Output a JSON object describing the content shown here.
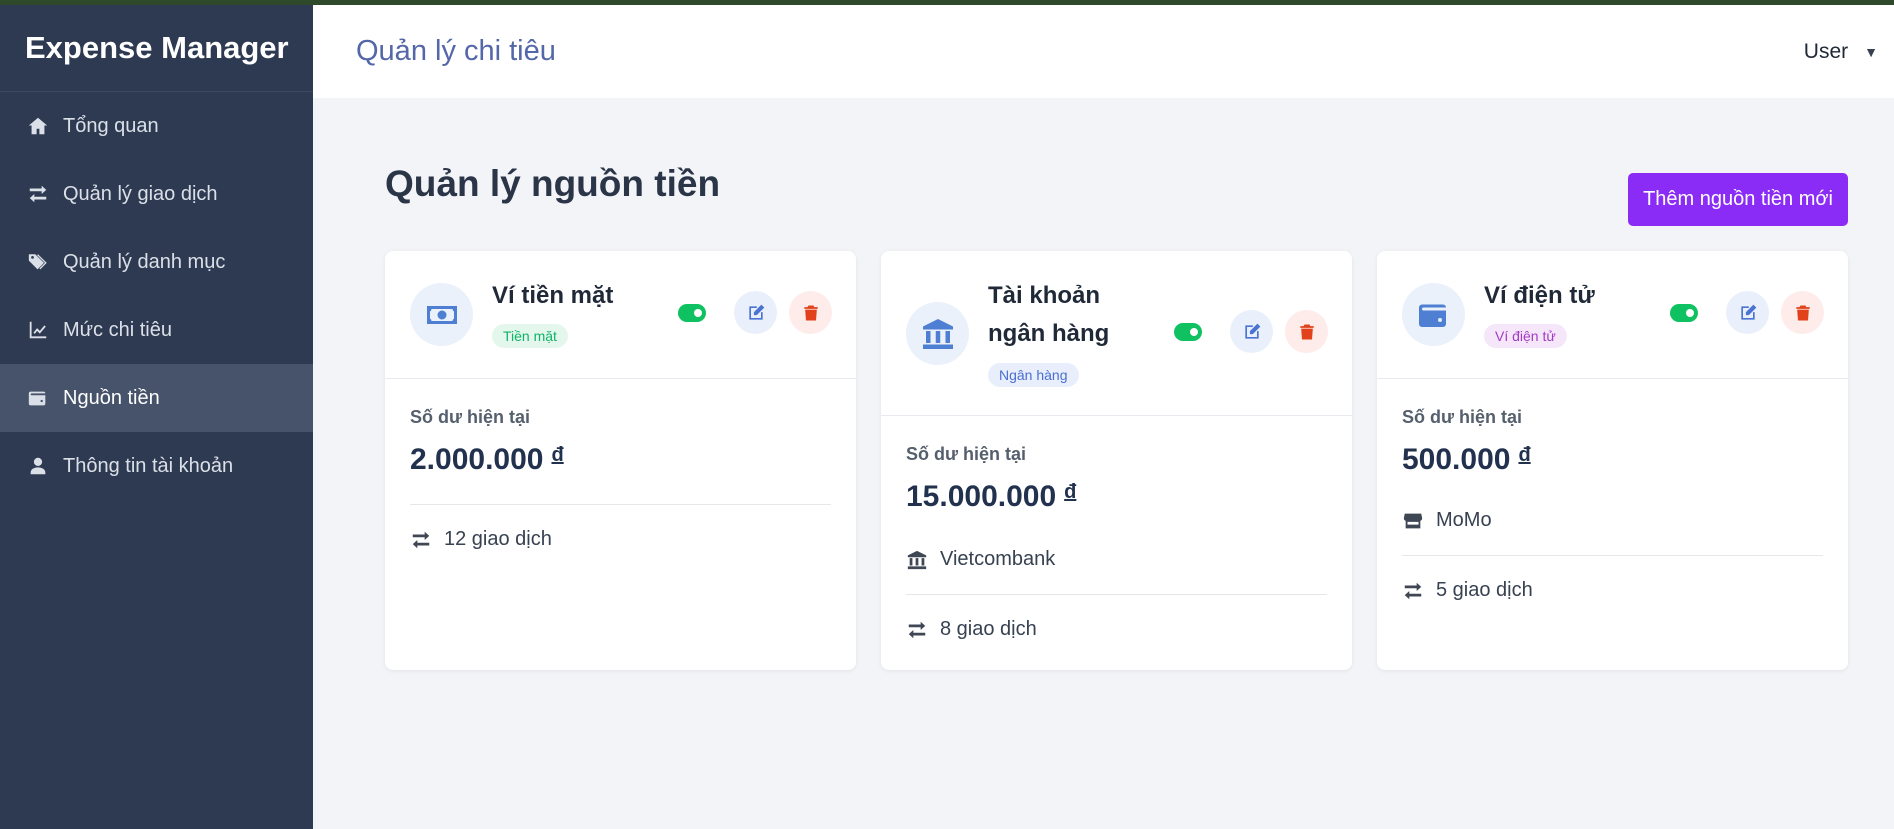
{
  "app": {
    "brand": "Expense Manager",
    "header_title": "Quản lý chi tiêu",
    "user_label": "User"
  },
  "sidebar": {
    "items": [
      {
        "label": "Tổng quan",
        "icon": "home-icon"
      },
      {
        "label": "Quản lý giao dịch",
        "icon": "exchange-icon"
      },
      {
        "label": "Quản lý danh mục",
        "icon": "tags-icon"
      },
      {
        "label": "Mức chi tiêu",
        "icon": "chart-line-icon"
      },
      {
        "label": "Nguồn tiền",
        "icon": "wallet-icon",
        "active": true
      },
      {
        "label": "Thông tin tài khoản",
        "icon": "user-icon"
      }
    ]
  },
  "page": {
    "title": "Quản lý nguồn tiền",
    "add_button": "Thêm nguồn tiền mới"
  },
  "sources": [
    {
      "name": "Ví tiền mặt",
      "type": "Tiền mặt",
      "icon": "money-bill-icon",
      "enabled": true,
      "balance_label": "Số dư hiện tại",
      "balance": "2.000.000",
      "currency": "đ",
      "transactions": "12 giao dịch"
    },
    {
      "name_line1": "Tài khoản",
      "name_line2": "ngân hàng",
      "type": "Ngân hàng",
      "icon": "bank-icon",
      "enabled": true,
      "balance_label": "Số dư hiện tại",
      "balance": "15.000.000",
      "currency": "đ",
      "provider": "Vietcombank",
      "transactions": "8 giao dịch"
    },
    {
      "name": "Ví điện tử",
      "type": "Ví điện tử",
      "icon": "wallet-icon",
      "enabled": true,
      "balance_label": "Số dư hiện tại",
      "balance": "500.000",
      "currency": "đ",
      "provider": "MoMo",
      "transactions": "5 giao dịch"
    }
  ],
  "colors": {
    "sidebar_bg": "#2d3a51",
    "accent": "#8a2cf6",
    "header_title": "#5467a8",
    "toggle_on": "#10c161",
    "badge_cash": "#10b36a",
    "badge_bank": "#4a6fd1",
    "badge_ewallet": "#a23bc4"
  }
}
